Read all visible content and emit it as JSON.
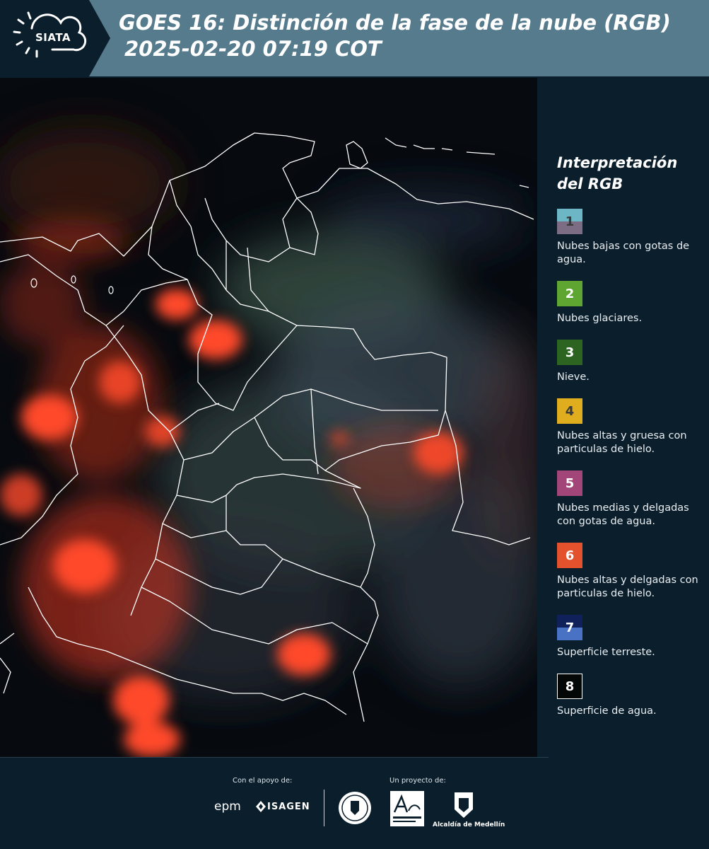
{
  "header": {
    "logo_text": "SIATA",
    "title_line1": "GOES 16: Distinción de la fase de la nube (RGB)",
    "title_line2": "2025-02-20 07:19 COT"
  },
  "legend": {
    "title_line1": "Interpretación",
    "title_line2": "del RGB",
    "items": [
      {
        "number": "1",
        "label": "Nubes bajas con gotas de agua.",
        "color_top": "#6cb6c6",
        "color_bottom": "#7c6d85"
      },
      {
        "number": "2",
        "label": "Nubes glaciares.",
        "color_top": "#5fa531",
        "color_bottom": "#5fa531"
      },
      {
        "number": "3",
        "label": "Nieve.",
        "color_top": "#2d6421",
        "color_bottom": "#2d6421"
      },
      {
        "number": "4",
        "label": "Nubes altas y gruesa con particulas de hielo.",
        "color_top": "#dfad1d",
        "color_bottom": "#dfad1d"
      },
      {
        "number": "5",
        "label": "Nubes medias y delgadas con gotas de agua.",
        "color_top": "#a2467a",
        "color_bottom": "#a2467a"
      },
      {
        "number": "6",
        "label": "Nubes altas y delgadas con particulas de hielo.",
        "color_top": "#e3512d",
        "color_bottom": "#e3512d"
      },
      {
        "number": "7",
        "label": "Superficie terreste.",
        "color_top": "#10205a",
        "color_bottom": "#4a72c4"
      },
      {
        "number": "8",
        "label": "Superficie de agua.",
        "color_top": "#030705",
        "color_bottom": "#030705"
      }
    ]
  },
  "footer": {
    "support_caption": "Con el apoyo de:",
    "project_caption": "Un proyecto de:",
    "sponsors": [
      "epm",
      "ISAGEN"
    ],
    "partners": [
      "Área Metropolitana",
      "Alcaldía de Medellín"
    ]
  },
  "colors": {
    "header_bg": "#557b8d",
    "page_bg": "#0b1e2b",
    "cloud_red": "#ff4a2a",
    "border_white": "#ffffff"
  }
}
